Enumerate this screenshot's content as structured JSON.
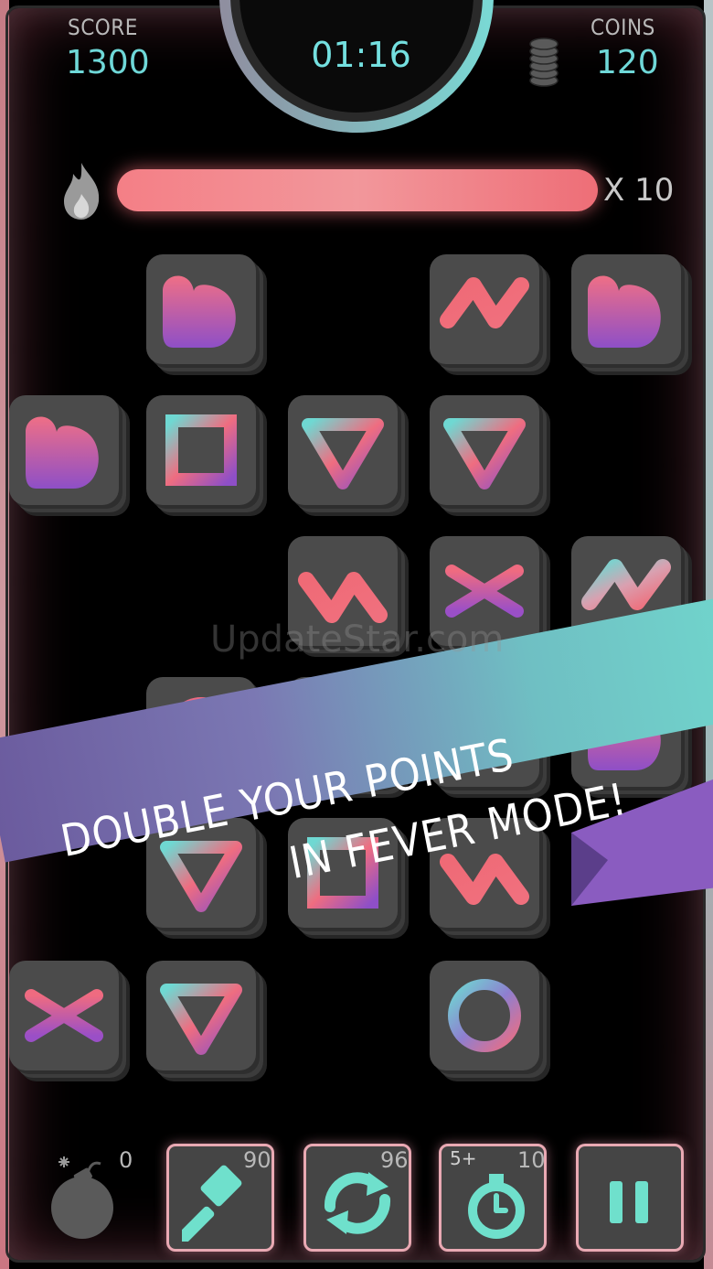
{
  "hud": {
    "score_label": "SCORE",
    "score_value": "1300",
    "timer": "01:16",
    "coins_label": "COINS",
    "coins_value": "120"
  },
  "fever": {
    "multiplier": "X 10",
    "fill_fraction": 1.0
  },
  "banner": {
    "line1": "DOUBLE YOUR POINTS",
    "line2": "IN FEVER MODE!"
  },
  "watermark": "UpdateStar.com",
  "powerups": {
    "bomb_count": "0",
    "hammer_count": "90",
    "shuffle_count": "96",
    "timer_bonus_label": "5+",
    "timer_bonus_count": "10"
  },
  "colors": {
    "accent_teal": "#6fd8d8",
    "fever_pink": "#f47f86",
    "tile_bg": "#4b4b4b",
    "purple": "#8a5cc0"
  },
  "icons": [
    "flame-icon",
    "coin-stack-icon",
    "bomb-icon",
    "hammer-icon",
    "shuffle-icon",
    "stopwatch-icon",
    "pause-icon"
  ]
}
